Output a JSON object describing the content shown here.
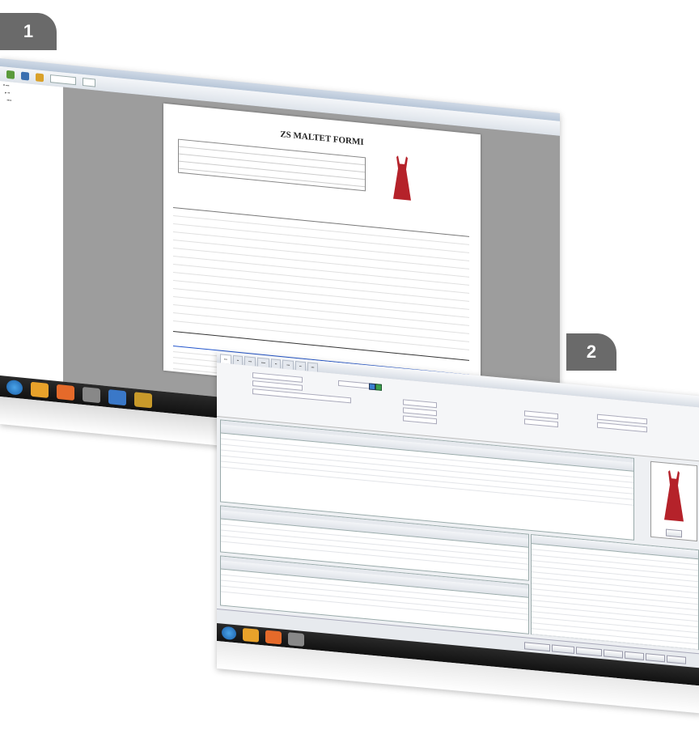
{
  "badges": {
    "first": "1",
    "second": "2"
  },
  "screenshot1": {
    "document_title": "ZS MALTET FORMI",
    "icons": [
      "start-orb-icon",
      "folder-icon",
      "media-icon",
      "tools-icon",
      "network-icon",
      "app-icon"
    ]
  },
  "screenshot2": {
    "icons": [
      "start-orb-icon",
      "folder-icon",
      "media-icon",
      "tools-icon"
    ]
  },
  "colors": {
    "badge": "#6a6a6a",
    "dress": "#b5222a",
    "taskbar": "#1a1a1a",
    "viewer_background": "#9d9d9d"
  }
}
